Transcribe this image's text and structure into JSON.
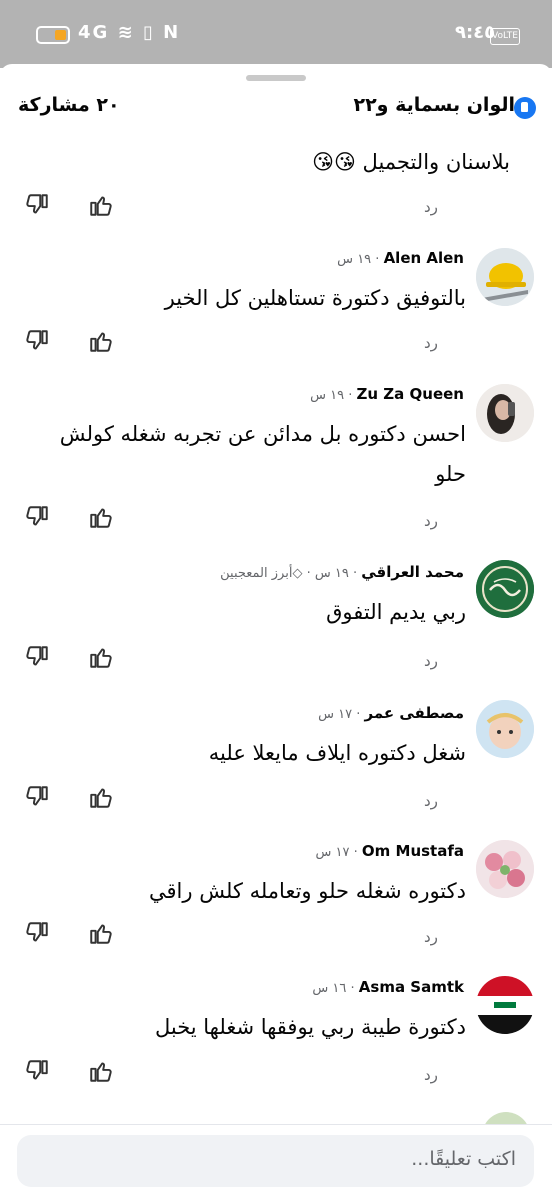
{
  "status_bar": {
    "time": "٩:٤٥",
    "volte": "VoLTE",
    "signal": "4G",
    "nfc": "N",
    "colors": {
      "bar": "#b3b3b3",
      "battery": "#f5a623"
    }
  },
  "header": {
    "reactions": "الوان بسماية و٢٢",
    "shares": "٢٠ مشاركة"
  },
  "actions": {
    "reply_label": "رد"
  },
  "comments": [
    {
      "name": "",
      "time": "",
      "text": "بلاسنان والتجميل 😘😘"
    },
    {
      "name": "Alen Alen",
      "time": "١٩ س",
      "text": "بالتوفيق دكتورة تستاهلين كل الخير",
      "avatar": "helmet-avatar"
    },
    {
      "name": "Zu Za Queen",
      "time": "١٩ س",
      "text": "احسن دكتوره بل مدائن عن تجربه شغله كولش حلو",
      "avatar": "selfie-avatar"
    },
    {
      "name": "محمد العراقي",
      "time": "١٩ س",
      "badge": "أبرز المعجبين",
      "text": "ربي يديم التفوق",
      "avatar": "calligraphy-avatar"
    },
    {
      "name": "مصطفى عمر",
      "time": "١٧ س",
      "text": "شغل دكتوره ايلاف مايعلا عليه",
      "avatar": "baby-avatar"
    },
    {
      "name": "Om Mustafa",
      "time": "١٧ س",
      "text": "دكتوره شغله حلو وتعامله كلش راقي",
      "avatar": "sweets-avatar"
    },
    {
      "name": "Asma Samtk",
      "time": "١٦ س",
      "text": "دكتورة طيبة ربي يوفقها شغلها يخبل",
      "avatar": "iraq-flag-avatar"
    }
  ],
  "composer": {
    "placeholder": "اكتب تعليقًا..."
  }
}
